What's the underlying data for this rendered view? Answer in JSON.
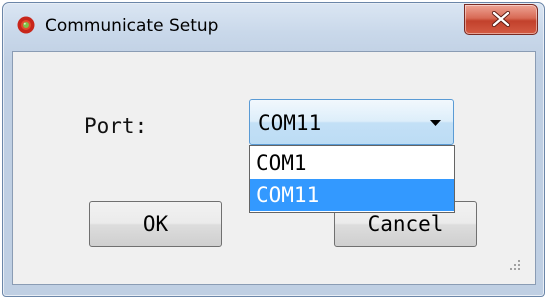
{
  "window": {
    "title": "Communicate Setup",
    "icon": "app-icon",
    "close_icon": "close-icon"
  },
  "form": {
    "port_label": "Port:",
    "port_selected": "COM11",
    "port_options": [
      "COM1",
      "COM11"
    ],
    "highlighted_option": "COM11"
  },
  "buttons": {
    "ok_label": "OK",
    "cancel_label": "Cancel"
  },
  "colors": {
    "selection": "#3399ff",
    "close_button": "#c2412c",
    "combo_border": "#5a9bd5"
  }
}
